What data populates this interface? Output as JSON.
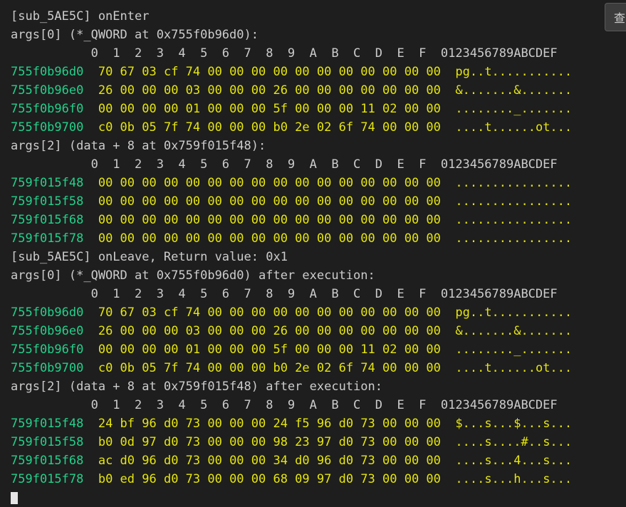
{
  "side_button": {
    "label": "查"
  },
  "lines": [
    {
      "type": "text",
      "text": "[sub_5AE5C] onEnter"
    },
    {
      "type": "text",
      "text": "args[0] (*_QWORD at 0x755f0b96d0):"
    },
    {
      "type": "header",
      "text": "           0  1  2  3  4  5  6  7  8  9  A  B  C  D  E  F  0123456789ABCDEF"
    },
    {
      "type": "row",
      "addr": "755f0b96d0",
      "hex": "70 67 03 cf 74 00 00 00 00 00 00 00 00 00 00 00",
      "ascii": "pg..t..........."
    },
    {
      "type": "row",
      "addr": "755f0b96e0",
      "hex": "26 00 00 00 03 00 00 00 26 00 00 00 00 00 00 00",
      "ascii": "&.......&......."
    },
    {
      "type": "row",
      "addr": "755f0b96f0",
      "hex": "00 00 00 00 01 00 00 00 5f 00 00 00 11 02 00 00",
      "ascii": "........_......."
    },
    {
      "type": "row",
      "addr": "755f0b9700",
      "hex": "c0 0b 05 7f 74 00 00 00 b0 2e 02 6f 74 00 00 00",
      "ascii": "....t......ot..."
    },
    {
      "type": "text",
      "text": "args[2] (data + 8 at 0x759f015f48):"
    },
    {
      "type": "header",
      "text": "           0  1  2  3  4  5  6  7  8  9  A  B  C  D  E  F  0123456789ABCDEF"
    },
    {
      "type": "row",
      "addr": "759f015f48",
      "hex": "00 00 00 00 00 00 00 00 00 00 00 00 00 00 00 00",
      "ascii": "................"
    },
    {
      "type": "row",
      "addr": "759f015f58",
      "hex": "00 00 00 00 00 00 00 00 00 00 00 00 00 00 00 00",
      "ascii": "................"
    },
    {
      "type": "row",
      "addr": "759f015f68",
      "hex": "00 00 00 00 00 00 00 00 00 00 00 00 00 00 00 00",
      "ascii": "................"
    },
    {
      "type": "row",
      "addr": "759f015f78",
      "hex": "00 00 00 00 00 00 00 00 00 00 00 00 00 00 00 00",
      "ascii": "................"
    },
    {
      "type": "text",
      "text": "[sub_5AE5C] onLeave, Return value: 0x1"
    },
    {
      "type": "text",
      "text": "args[0] (*_QWORD at 0x755f0b96d0) after execution:"
    },
    {
      "type": "header",
      "text": "           0  1  2  3  4  5  6  7  8  9  A  B  C  D  E  F  0123456789ABCDEF"
    },
    {
      "type": "row",
      "addr": "755f0b96d0",
      "hex": "70 67 03 cf 74 00 00 00 00 00 00 00 00 00 00 00",
      "ascii": "pg..t..........."
    },
    {
      "type": "row",
      "addr": "755f0b96e0",
      "hex": "26 00 00 00 03 00 00 00 26 00 00 00 00 00 00 00",
      "ascii": "&.......&......."
    },
    {
      "type": "row",
      "addr": "755f0b96f0",
      "hex": "00 00 00 00 01 00 00 00 5f 00 00 00 11 02 00 00",
      "ascii": "........_......."
    },
    {
      "type": "row",
      "addr": "755f0b9700",
      "hex": "c0 0b 05 7f 74 00 00 00 b0 2e 02 6f 74 00 00 00",
      "ascii": "....t......ot..."
    },
    {
      "type": "text",
      "text": "args[2] (data + 8 at 0x759f015f48) after execution:"
    },
    {
      "type": "header",
      "text": "           0  1  2  3  4  5  6  7  8  9  A  B  C  D  E  F  0123456789ABCDEF"
    },
    {
      "type": "row",
      "addr": "759f015f48",
      "hex": "24 bf 96 d0 73 00 00 00 24 f5 96 d0 73 00 00 00",
      "ascii": "$...s...$...s..."
    },
    {
      "type": "row",
      "addr": "759f015f58",
      "hex": "b0 0d 97 d0 73 00 00 00 98 23 97 d0 73 00 00 00",
      "ascii": "....s....#..s..."
    },
    {
      "type": "row",
      "addr": "759f015f68",
      "hex": "ac d0 96 d0 73 00 00 00 34 d0 96 d0 73 00 00 00",
      "ascii": "....s...4...s..."
    },
    {
      "type": "row",
      "addr": "759f015f78",
      "hex": "b0 ed 96 d0 73 00 00 00 68 09 97 d0 73 00 00 00",
      "ascii": "....s...h...s..."
    },
    {
      "type": "cursor"
    }
  ]
}
